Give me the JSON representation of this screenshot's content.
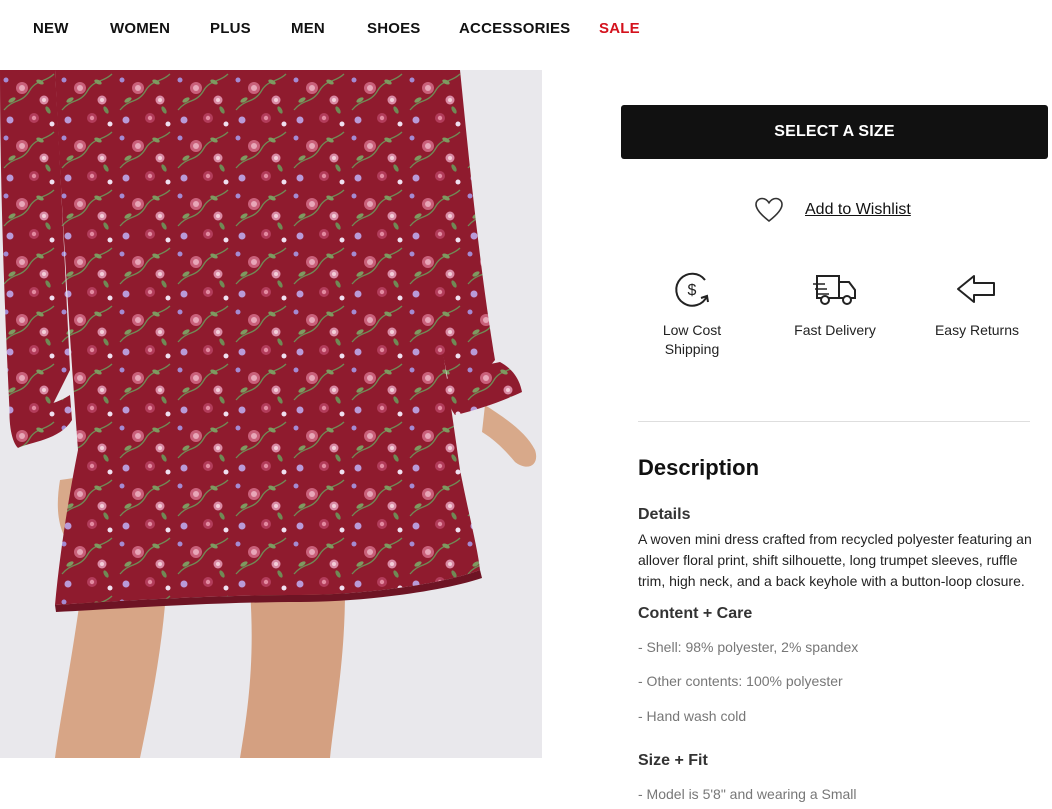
{
  "nav": {
    "items": [
      {
        "label": "NEW"
      },
      {
        "label": "WOMEN"
      },
      {
        "label": "PLUS"
      },
      {
        "label": "MEN"
      },
      {
        "label": "SHOES"
      },
      {
        "label": "ACCESSORIES"
      },
      {
        "label": "SALE"
      }
    ],
    "sale_color": "#d4111c"
  },
  "product": {
    "image": {
      "subject": "burgundy floral mini dress",
      "bg_color": "#e9e8ec",
      "dress_color": "#8f1b2e"
    }
  },
  "actions": {
    "select_size_label": "SELECT A SIZE",
    "wishlist_label": "Add to Wishlist",
    "wishlist_icon": "heart-outline-icon"
  },
  "perks": [
    {
      "icon": "dollar-refresh-icon",
      "label_line1": "Low Cost",
      "label_line2": "Shipping"
    },
    {
      "icon": "delivery-truck-icon",
      "label_line1": "Fast Delivery"
    },
    {
      "icon": "return-arrow-icon",
      "label_line1": "Easy Returns"
    }
  ],
  "description": {
    "title": "Description",
    "details_heading": "Details",
    "details_text": "A woven mini dress crafted from recycled polyester featuring an allover floral print, shift silhouette, long trumpet sleeves, ruffle trim, high neck, and a back keyhole with a button-loop closure.",
    "care_heading": "Content + Care",
    "care_items": [
      "- Shell: 98% polyester, 2% spandex",
      "- Other contents: 100% polyester",
      "- Hand wash cold"
    ],
    "fit_heading": "Size + Fit",
    "fit_items": [
      "- Model is 5'8\" and wearing a Small"
    ]
  }
}
